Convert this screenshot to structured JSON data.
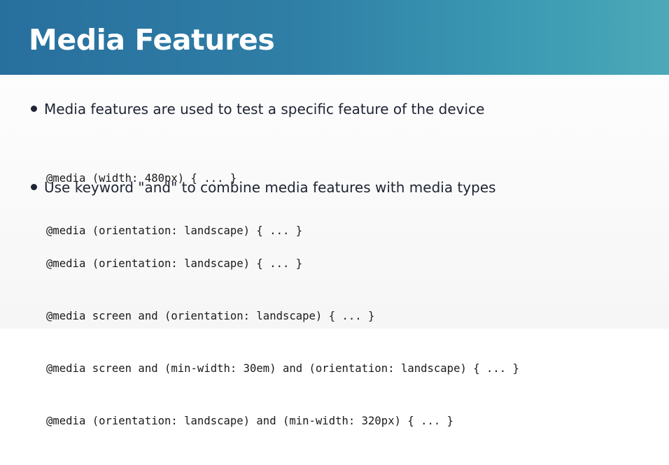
{
  "slide": {
    "title": "Media Features",
    "bullets": [
      {
        "text": "Media features are used to test a specific feature of the device",
        "code": [
          "@media (width: 480px) { ... }",
          "@media (orientation: landscape) { ... }"
        ]
      },
      {
        "text": "Use keyword \"and\" to combine media features with media types",
        "code": [
          "@media (orientation: landscape) { ... }",
          "@media screen and (orientation: landscape) { ... }",
          "@media screen and (min-width: 30em) and (orientation: landscape) { ... }",
          "@media (orientation: landscape) and (min-width: 320px) { ... }"
        ]
      }
    ]
  },
  "colors": {
    "header_start": "#286f9e",
    "header_end": "#4ba9b8",
    "title_text": "#ffffff",
    "body_text": "#1e2433"
  }
}
